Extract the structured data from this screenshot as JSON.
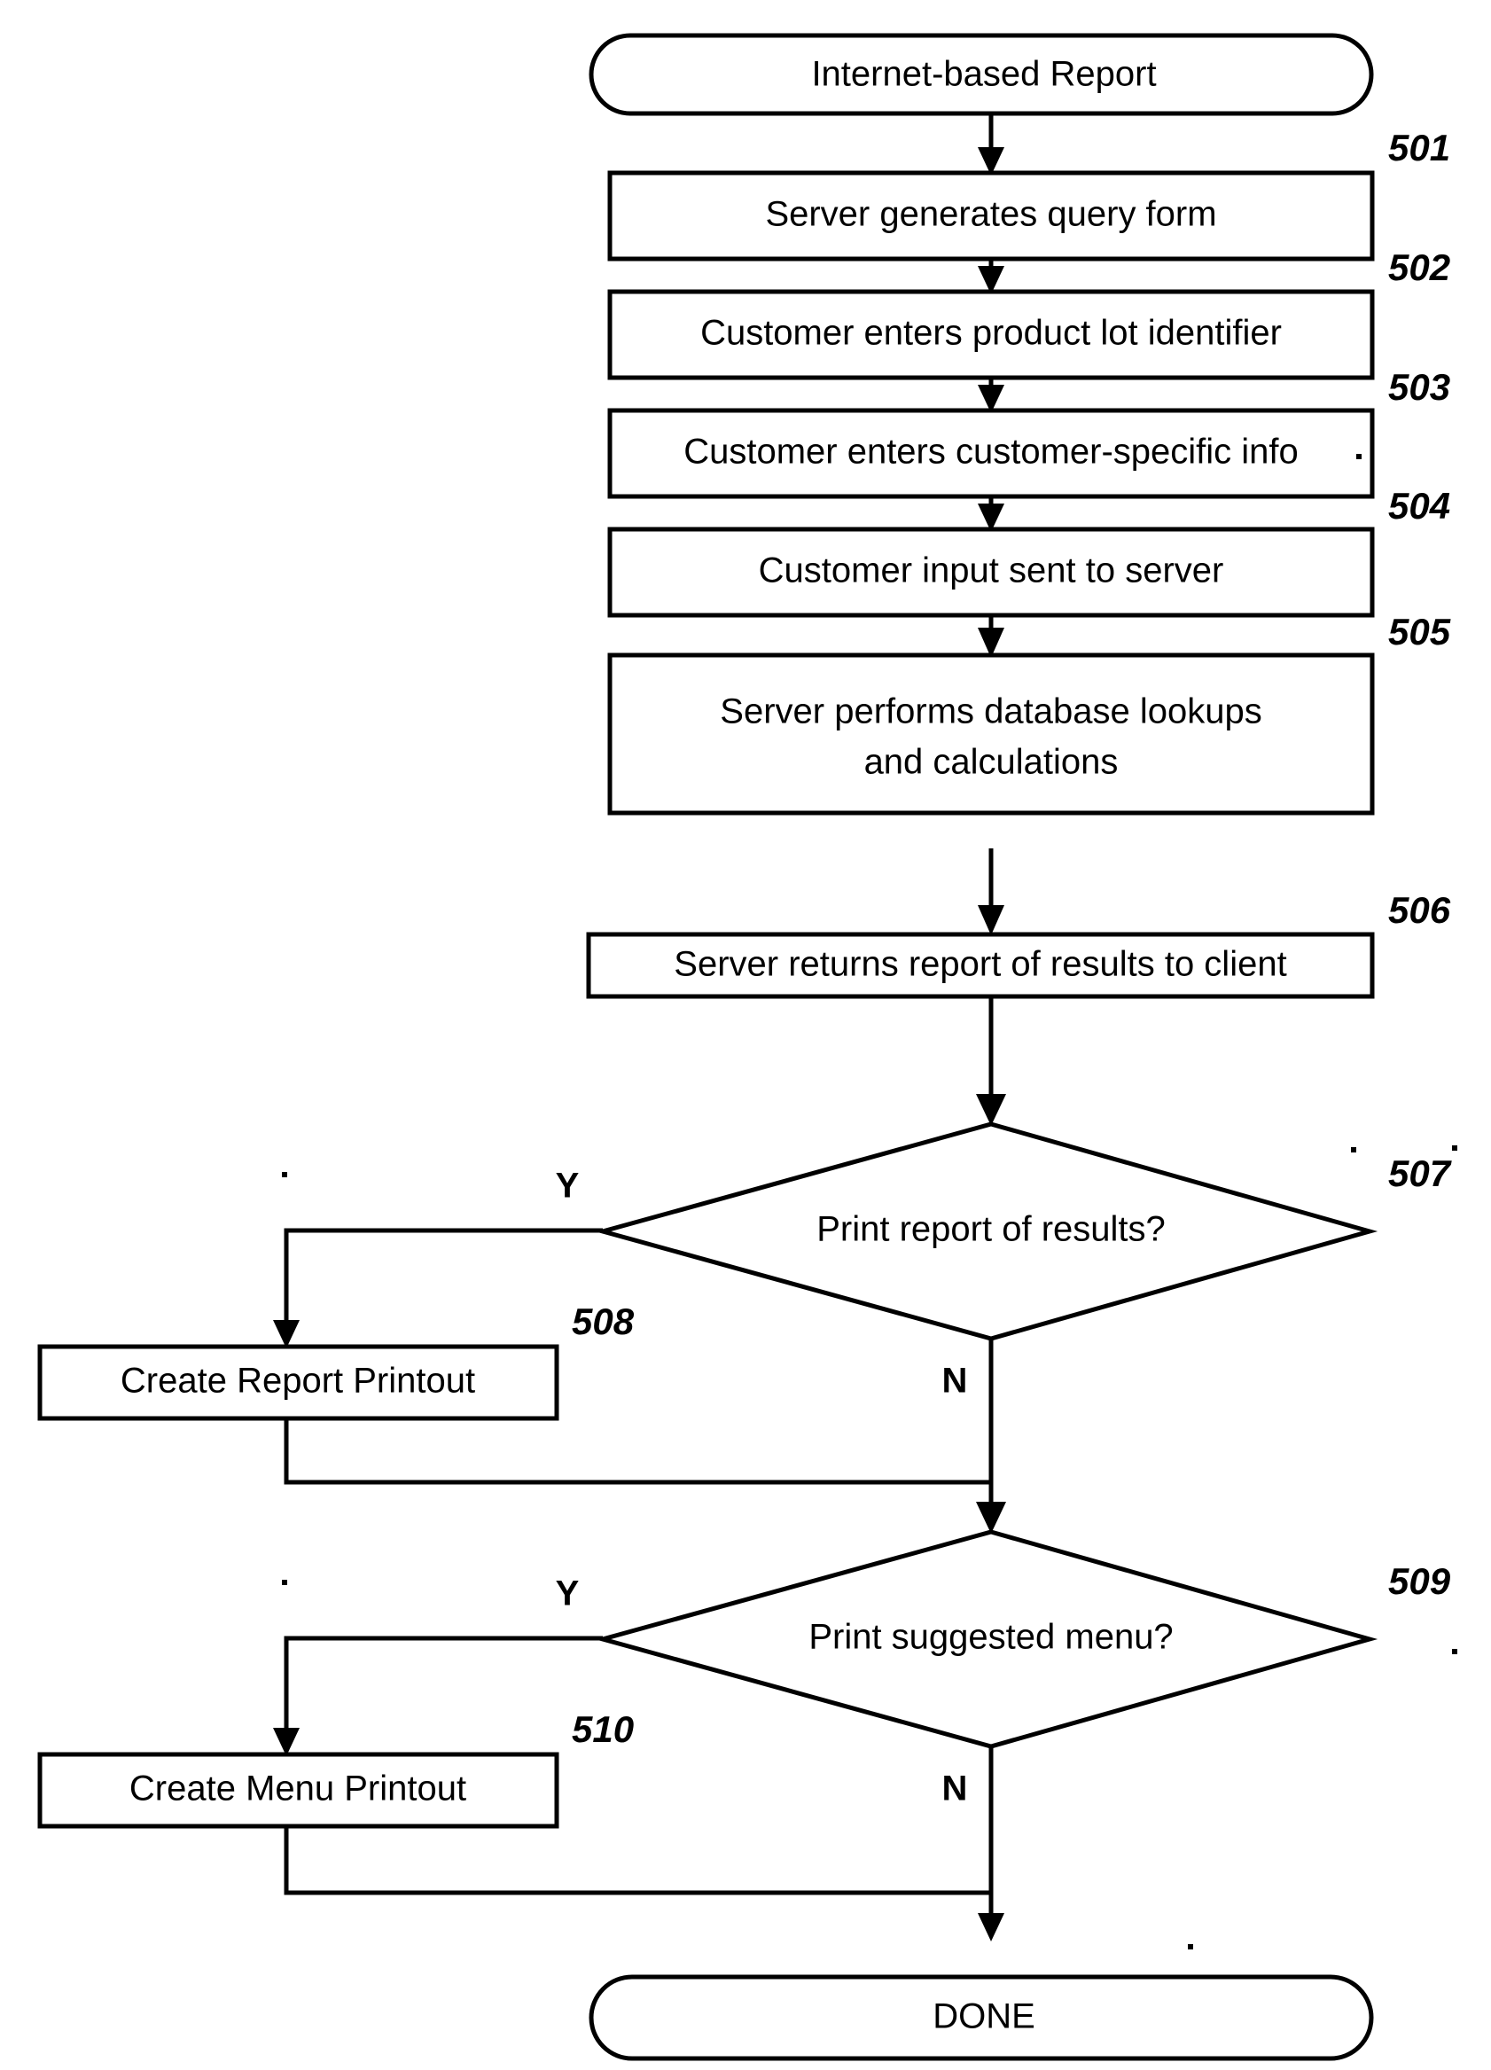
{
  "diagram": {
    "title": "Internet-based Report flowchart",
    "stroke_color": "#000000",
    "background_color": "#ffffff",
    "nodes": [
      {
        "id": "start",
        "type": "terminator",
        "label": "Internet-based Report",
        "ref": ""
      },
      {
        "id": "n501",
        "type": "process",
        "label": "Server generates query form",
        "ref": "501"
      },
      {
        "id": "n502",
        "type": "process",
        "label": "Customer enters product lot identifier",
        "ref": "502"
      },
      {
        "id": "n503",
        "type": "process",
        "label": "Customer enters customer-specific info",
        "ref": "503"
      },
      {
        "id": "n504",
        "type": "process",
        "label": "Customer input sent to server",
        "ref": "504"
      },
      {
        "id": "n505",
        "type": "process",
        "label": "Server performs database lookups and calculations",
        "label_line1": "Server performs database lookups",
        "label_line2": "and calculations",
        "ref": "505"
      },
      {
        "id": "n506",
        "type": "process",
        "label": "Server returns report of results to client",
        "ref": "506"
      },
      {
        "id": "n507",
        "type": "decision",
        "label": "Print report of results?",
        "ref": "507"
      },
      {
        "id": "n508",
        "type": "process",
        "label": "Create Report Printout",
        "ref": "508"
      },
      {
        "id": "n509",
        "type": "decision",
        "label": "Print suggested menu?",
        "ref": "509"
      },
      {
        "id": "n510",
        "type": "process",
        "label": "Create Menu Printout",
        "ref": "510"
      },
      {
        "id": "done",
        "type": "terminator",
        "label": "DONE",
        "ref": ""
      }
    ],
    "branch_labels": {
      "yes": "Y",
      "no": "N"
    },
    "edges": [
      {
        "from": "start",
        "to": "n501",
        "label": ""
      },
      {
        "from": "n501",
        "to": "n502",
        "label": ""
      },
      {
        "from": "n502",
        "to": "n503",
        "label": ""
      },
      {
        "from": "n503",
        "to": "n504",
        "label": ""
      },
      {
        "from": "n504",
        "to": "n505",
        "label": ""
      },
      {
        "from": "n505",
        "to": "n506",
        "label": ""
      },
      {
        "from": "n506",
        "to": "n507",
        "label": ""
      },
      {
        "from": "n507",
        "to": "n508",
        "label": "Y"
      },
      {
        "from": "n507",
        "to": "n509",
        "label": "N"
      },
      {
        "from": "n508",
        "to": "n509",
        "label": ""
      },
      {
        "from": "n509",
        "to": "n510",
        "label": "Y"
      },
      {
        "from": "n509",
        "to": "done",
        "label": "N"
      },
      {
        "from": "n510",
        "to": "done",
        "label": ""
      }
    ]
  }
}
